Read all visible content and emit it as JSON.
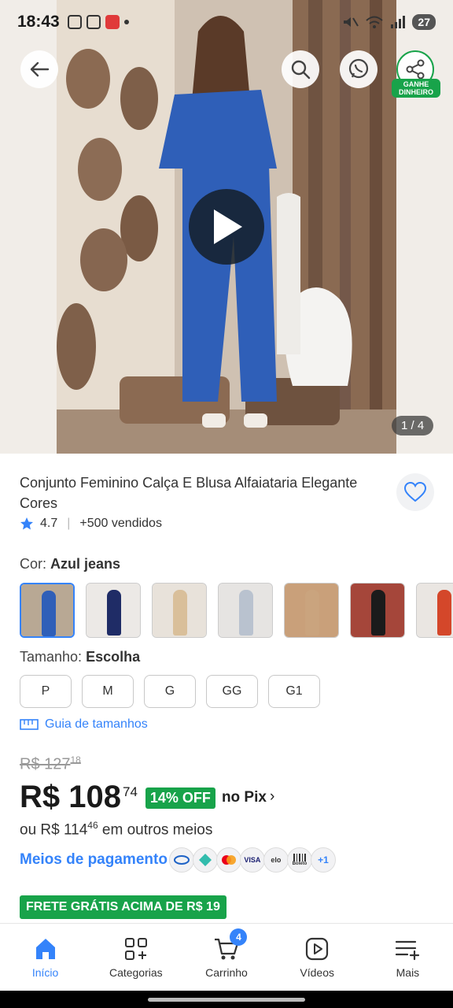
{
  "status_bar": {
    "time": "18:43",
    "battery": "27"
  },
  "hero": {
    "share_badge": "GANHE DINHEIRO",
    "image_counter": "1 / 4"
  },
  "product": {
    "title": "Conjunto Feminino Calça E Blusa Alfaiataria Elegante Cores",
    "rating": "4.7",
    "sold": "+500 vendidos"
  },
  "color": {
    "label": "Cor:",
    "selected": "Azul jeans",
    "swatches": [
      {
        "bg": "#b8a894",
        "dress": "#2f5fb8"
      },
      {
        "bg": "#ece9e6",
        "dress": "#1f2c66"
      },
      {
        "bg": "#e8e2da",
        "dress": "#d9bf9a"
      },
      {
        "bg": "#e6e4e2",
        "dress": "#b9c2cf"
      },
      {
        "bg": "#c9a07a",
        "dress": "#caa47e"
      },
      {
        "bg": "#a5463a",
        "dress": "#1b1b1b"
      },
      {
        "bg": "#eae6e2",
        "dress": "#d4472a"
      }
    ]
  },
  "size": {
    "label": "Tamanho:",
    "selected": "Escolha",
    "options": [
      "P",
      "M",
      "G",
      "GG",
      "G1"
    ],
    "guide": "Guia de tamanhos"
  },
  "price": {
    "old_main": "R$ 127",
    "old_cents": "18",
    "main": "R$ 108",
    "cents": "74",
    "off": "14% OFF",
    "pix": "no Pix",
    "other_prefix": "ou R$ 114",
    "other_cents": "46",
    "other_suffix": "em outros meios"
  },
  "payment": {
    "link": "Meios de pagamento",
    "methods": [
      "",
      "",
      "",
      "VISA",
      "elo",
      "Boleto"
    ],
    "more": "+1"
  },
  "shipping": {
    "badge": "FRETE GRÁTIS ACIMA DE R$ 19"
  },
  "nav": {
    "items": [
      {
        "label": "Início"
      },
      {
        "label": "Categorias"
      },
      {
        "label": "Carrinho"
      },
      {
        "label": "Vídeos"
      },
      {
        "label": "Mais"
      }
    ],
    "cart_count": "4"
  },
  "colors": {
    "accent": "#3483fa",
    "green": "#18a34a"
  }
}
